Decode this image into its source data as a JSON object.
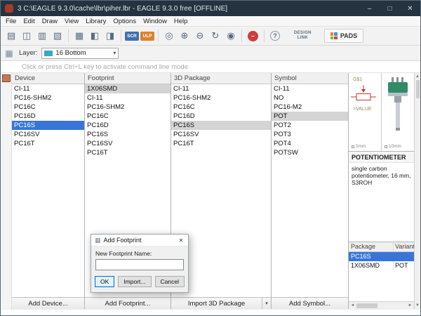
{
  "window": {
    "title": "3 C:\\EAGLE 9.3.0\\cache\\lbr\\piher.lbr - EAGLE 9.3.0 free [OFFLINE]",
    "minimize": "–",
    "maximize": "□",
    "close": "✕"
  },
  "menubar": [
    "File",
    "Edit",
    "Draw",
    "View",
    "Library",
    "Options",
    "Window",
    "Help"
  ],
  "toolbar": {
    "icons": [
      {
        "name": "open-library-icon",
        "glyph": "▤"
      },
      {
        "name": "save-icon",
        "glyph": "◫"
      },
      {
        "name": "print-icon",
        "glyph": "▥"
      },
      {
        "name": "export-icon",
        "glyph": "▧"
      },
      {
        "sep": true
      },
      {
        "name": "table-of-contents-icon",
        "glyph": "▦"
      },
      {
        "name": "device-editor-icon",
        "glyph": "◧"
      },
      {
        "name": "footprint-editor-icon",
        "glyph": "◨"
      },
      {
        "sep": true
      },
      {
        "name": "script-icon",
        "glyph": "SCR",
        "badge": "#3f6fae"
      },
      {
        "name": "ulp-icon",
        "glyph": "ULP",
        "badge": "#d9822b"
      },
      {
        "sep": true
      },
      {
        "name": "zoom-fit-icon",
        "glyph": "◎"
      },
      {
        "name": "zoom-in-icon",
        "glyph": "⊕"
      },
      {
        "name": "zoom-out-icon",
        "glyph": "⊖"
      },
      {
        "name": "zoom-redraw-icon",
        "glyph": "↻"
      },
      {
        "name": "zoom-select-icon",
        "glyph": "◉"
      },
      {
        "sep": true
      },
      {
        "name": "stop-icon",
        "glyph": "–",
        "bg": "#d23b3b",
        "fg": "#ffffff"
      },
      {
        "sep": true
      },
      {
        "name": "help-icon",
        "glyph": "?",
        "circle": true
      }
    ],
    "design_link_line1": "DESIGN",
    "design_link_line2": "LINK",
    "pads_label": "PADS"
  },
  "layerbar": {
    "grid_glyph": "▦",
    "label": "Layer:",
    "selected": "16 Bottom",
    "swatch_color": "#3ba7c4",
    "dropdown_glyph": "▾"
  },
  "commandbar": {
    "hint": "Click or press Ctrl+L key to activate command line mode"
  },
  "columns": {
    "device": {
      "header": "Device",
      "items": [
        {
          "label": "CI-11"
        },
        {
          "label": "PC16-SHM2"
        },
        {
          "label": "PC16C"
        },
        {
          "label": "PC16D"
        },
        {
          "label": "PC16S",
          "state": "selected"
        },
        {
          "label": "PC16SV"
        },
        {
          "label": "PC16T"
        }
      ],
      "footer": "Add Device..."
    },
    "footprint": {
      "header": "Footprint",
      "items": [
        {
          "label": "1X06SMD",
          "state": "highlight"
        },
        {
          "label": "CI-11"
        },
        {
          "label": "PC16-SHM2"
        },
        {
          "label": "PC16C"
        },
        {
          "label": "PC16D"
        },
        {
          "label": "PC16S"
        },
        {
          "label": "PC16SV"
        },
        {
          "label": "PC16T"
        }
      ],
      "footer": "Add Footprint..."
    },
    "package3d": {
      "header": "3D Package",
      "items": [
        {
          "label": "CI-11"
        },
        {
          "label": "PC16-SHM2"
        },
        {
          "label": "PC16C"
        },
        {
          "label": "PC16D"
        },
        {
          "label": "PC16S",
          "state": "highlight"
        },
        {
          "label": "PC16SV"
        },
        {
          "label": "PC16T"
        }
      ],
      "footer": "Import 3D Package",
      "dropdown_glyph": "▾"
    },
    "symbol": {
      "header": "Symbol",
      "items": [
        {
          "label": "CI-11"
        },
        {
          "label": "NO"
        },
        {
          "label": "PC16-M2"
        },
        {
          "label": "POT",
          "state": "highlight"
        },
        {
          "label": "POT2"
        },
        {
          "label": "POT3"
        },
        {
          "label": "POT4"
        },
        {
          "label": "POTSW"
        }
      ],
      "footer": "Add Symbol..."
    }
  },
  "preview": {
    "symbol": {
      "gate_name": "G$1",
      "value_text": ">VALUE",
      "scale": "5mm"
    },
    "package3d": {
      "scale": "10mm"
    },
    "description_title": "POTENTIOMETER",
    "description_text": "single carbon potentiometer, 16 mm, S3ROH"
  },
  "package_table": {
    "headers": [
      "Package",
      "Variant"
    ],
    "rows": [
      {
        "cells": [
          "PC16S",
          ""
        ],
        "state": "selected"
      },
      {
        "cells": [
          "1X06SMD",
          "POT"
        ]
      }
    ]
  },
  "dialog": {
    "icon_glyph": "▦",
    "title": "Add Footprint",
    "label": "New Footprint Name:",
    "input_value": "",
    "ok": "OK",
    "import": "Import...",
    "cancel": "Cancel",
    "close": "✕"
  },
  "glyphs": {
    "up": "▲",
    "down": "▼",
    "left": "◄",
    "right": "►"
  }
}
